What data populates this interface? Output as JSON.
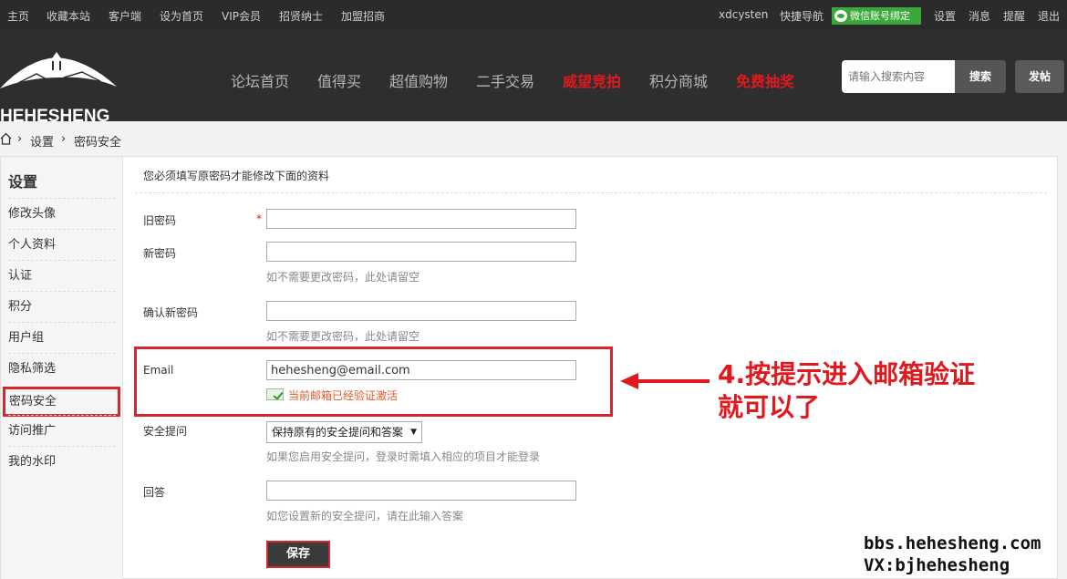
{
  "topbar": {
    "links": [
      "主页",
      "收藏本站",
      "客户端",
      "设为首页",
      "VIP会员",
      "招贤纳士",
      "加盟招商"
    ],
    "username": "xdcysten",
    "quick_nav": "快捷导航",
    "wechat_bind": "微信账号绑定",
    "right_links": [
      "设置",
      "消息",
      "提醒",
      "退出"
    ]
  },
  "header": {
    "logo_text": "HEHESHENG",
    "nav": [
      {
        "label": "论坛首页",
        "hot": false
      },
      {
        "label": "值得买",
        "hot": false
      },
      {
        "label": "超值购物",
        "hot": false
      },
      {
        "label": "二手交易",
        "hot": false
      },
      {
        "label": "威望竞拍",
        "hot": true
      },
      {
        "label": "积分商城",
        "hot": false
      },
      {
        "label": "免费抽奖",
        "hot": true
      }
    ],
    "search_placeholder": "请输入搜索内容",
    "search_button": "搜索",
    "post_button": "发帖"
  },
  "breadcrumb": [
    "设置",
    "密码安全"
  ],
  "sidebar": {
    "title": "设置",
    "items": [
      "修改头像",
      "个人资料",
      "认证",
      "积分",
      "用户组",
      "隐私筛选",
      "密码安全",
      "访问推广",
      "我的水印"
    ],
    "active_index": 6
  },
  "form": {
    "notice": "您必须填写原密码才能修改下面的资料",
    "old_password_label": "旧密码",
    "required_mark": "*",
    "new_password_label": "新密码",
    "new_password_hint": "如不需要更改密码，此处请留空",
    "confirm_password_label": "确认新密码",
    "confirm_password_hint": "如不需要更改密码，此处请留空",
    "email_label": "Email",
    "email_value": "hehesheng@email.com",
    "email_verified": "当前邮箱已经验证激活",
    "question_label": "安全提问",
    "question_selected": "保持原有的安全提问和答案",
    "question_hint": "如果您启用安全提问，登录时需填入相应的项目才能登录",
    "answer_label": "回答",
    "answer_hint": "如您设置新的安全提问，请在此输入答案",
    "save_button": "保存"
  },
  "annotation": {
    "line1": "4.按提示进入邮箱验证",
    "line2": "就可以了",
    "color": "#e0191e"
  },
  "watermark": {
    "line1": "bbs.hehesheng.com",
    "line2": "VX:bjhehesheng"
  }
}
